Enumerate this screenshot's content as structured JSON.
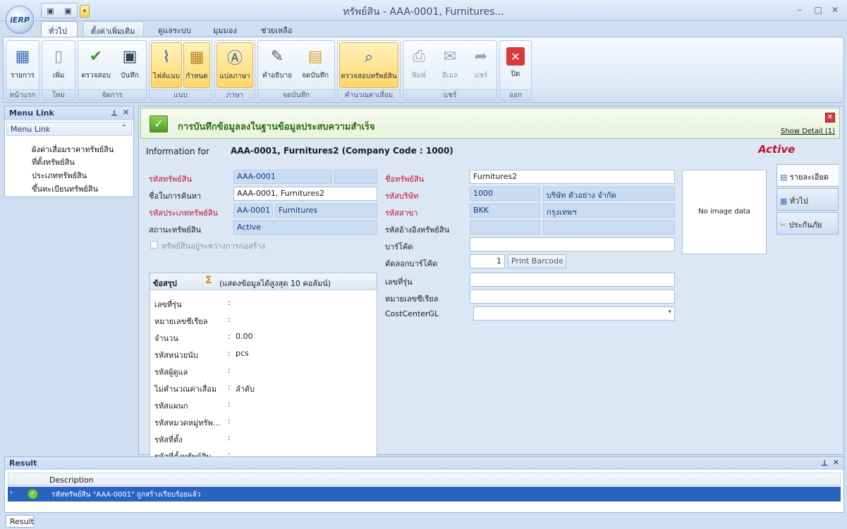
{
  "app": {
    "logo_text": "iERP",
    "window_title": "ทรัพย์สิน - AAA-0001, Furnitures...",
    "win_min": "–",
    "win_max": "□",
    "win_close": "✕"
  },
  "tabs": [
    "ทั่วไป",
    "ตั้งค่าเพิ่มเติม",
    "ดูแลระบบ",
    "มุมมอง",
    "ช่วยเหลือ"
  ],
  "ribbon": {
    "groups": {
      "home": "หน้าแรก",
      "new": "ใหม่",
      "manage": "จัดการ",
      "attach": "แนบ",
      "language": "ภาษา",
      "note": "จดบันทึก",
      "depr": "คำนวณค่าเสื่อม",
      "share": "แชร์",
      "exit": "ออก"
    },
    "buttons": {
      "list": "รายการ",
      "add": "เพิ่ม",
      "check": "ตรวจสอบ",
      "save": "บันทึก",
      "attach_file": "ไฟล์แนบ",
      "define": "กำหนด",
      "translate": "แปลภาษา",
      "description": "คำอธิบาย",
      "memo": "จดบันทึก",
      "check_asset": "ตรวจสอบทรัพย์สิน",
      "print": "พิมพ์",
      "email": "อีเมล",
      "share": "แชร์",
      "close": "ปิด"
    }
  },
  "menu_link": {
    "title": "Menu Link",
    "section": "Menu Link",
    "items": [
      "ผังค่าเสื่อมราคาทรัพย์สิน",
      "ที่ตั้งทรัพย์สิน",
      "ประเภททรัพย์สิน",
      "ขึ้นทะเบียนทรัพย์สิน"
    ]
  },
  "banner": {
    "message": "การบันทึกข้อมูลลงในฐานข้อมูลประสบความสำเร็จ",
    "show_detail": "Show Detail (1)"
  },
  "info": {
    "label": "Information for",
    "value": "AAA-0001, Furnitures2 (Company Code : 1000)",
    "status": "Active"
  },
  "form": {
    "asset_code_label": "รหัสทรัพย์สิน",
    "asset_code": "AAA-0001",
    "search_name_label": "ชื่อในการค้นหา",
    "search_name": "AAA-0001, Furnitures2",
    "asset_type_label": "รหัสประเภททรัพย์สิน",
    "asset_type_code": "AA-0001",
    "asset_type_name": "Furnitures",
    "asset_status_label": "สถานะทรัพย์สิน",
    "asset_status": "Active",
    "under_construction_label": "ทรัพย์สินอยู่ระหว่างการก่อสร้าง",
    "asset_name_label": "ชื่อทรัพย์สิน",
    "asset_name": "Furnitures2",
    "company_label": "รหัสบริษัท",
    "company_code": "1000",
    "company_name": "บริษัท ตัวอย่าง จำกัด",
    "branch_label": "รหัสสาขา",
    "branch_code": "BKK",
    "branch_name": "กรุงเทพฯ",
    "ref_asset_label": "รหัสอ้างอิงทรัพย์สิน",
    "barcode_label": "บาร์โค้ด",
    "copy_barcode_label": "คัดลอกบาร์โค้ด",
    "copy_barcode_value": "1",
    "print_barcode": "Print Barcode",
    "model_label": "เลขที่รุ่น",
    "serial_label": "หมายเลขซีเรียล",
    "costcenter_label": "CostCenterGL",
    "no_image": "No image data"
  },
  "summary": {
    "title": "ข้อสรุป",
    "note": "(แสดงข้อมูลได้สูงสุด 10 คอลัมน์)",
    "rows": [
      {
        "label": "เลขที่รุ่น",
        "value": ""
      },
      {
        "label": "หมายเลขซีเรียล",
        "value": ""
      },
      {
        "label": "จำนวน",
        "value": "0.00"
      },
      {
        "label": "รหัสหน่วยนับ",
        "value": "pcs"
      },
      {
        "label": "รหัสผู้ดูแล",
        "value": ""
      },
      {
        "label": "ไม่คำนวณค่าเสื่อม",
        "value": "ลำดับ"
      },
      {
        "label": "รหัสแผนก",
        "value": ""
      },
      {
        "label": "รหัสหมวดหมู่ทรัพ...",
        "value": ""
      },
      {
        "label": "รหัสที่ตั้ง",
        "value": ""
      },
      {
        "label": "รหัสที่ตั้งทรัพย์สิน",
        "value": ""
      }
    ]
  },
  "side_tabs": [
    "รายละเอียด",
    "ทั่วไป",
    "ประกันภัย"
  ],
  "result": {
    "title": "Result",
    "col_description": "Description",
    "row_text": "รหัสทรัพย์สิน \"AAA-0001\" ถูกสร้างเรียบร้อยแล้ว",
    "tab": "Result"
  },
  "colors": {
    "required_label": "#c8102e",
    "success_green": "#2b6b12",
    "selection_blue": "#2a63c1"
  }
}
